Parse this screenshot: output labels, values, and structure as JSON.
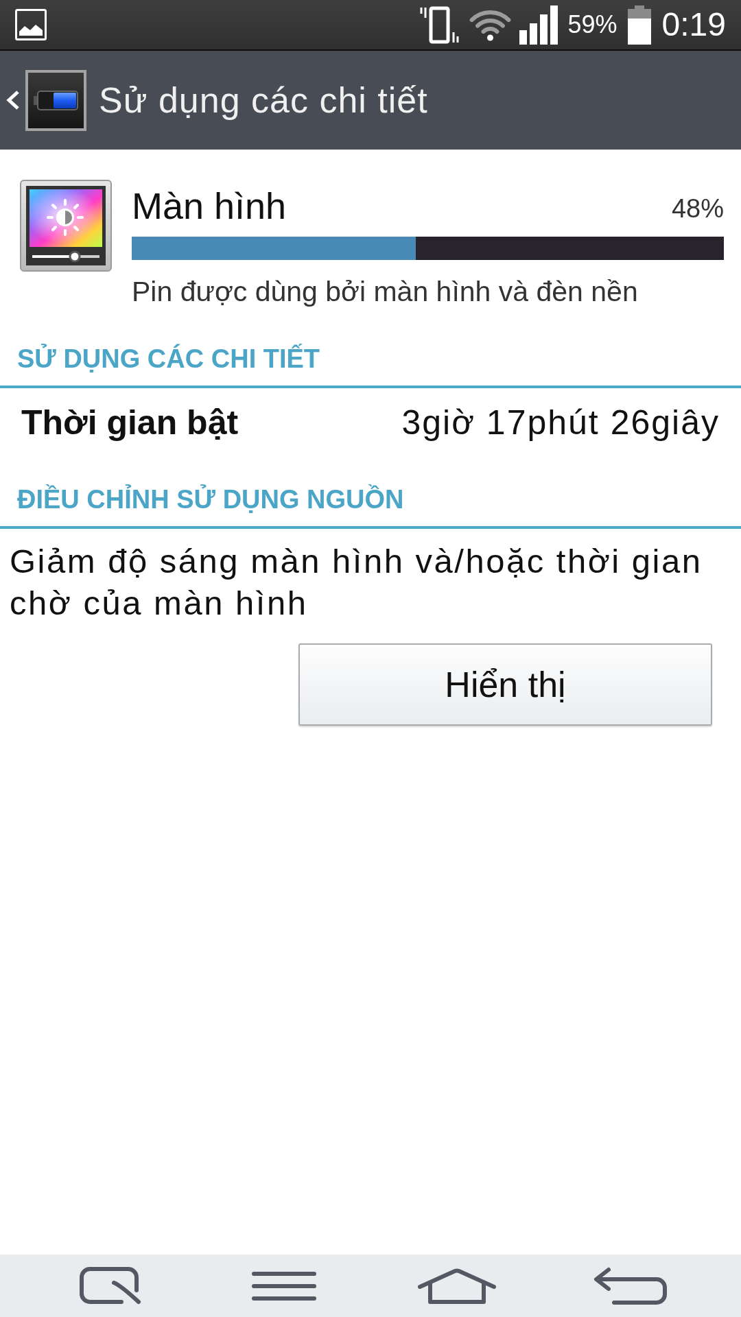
{
  "status_bar": {
    "battery": "59%",
    "time": "0:19"
  },
  "app_bar": {
    "title": "Sử dụng các chi tiết"
  },
  "usage": {
    "name": "Màn hình",
    "percent": "48%",
    "level": 0.48,
    "description": "Pin được dùng bởi màn hình và đèn nền"
  },
  "sections": [
    {
      "kind": "detail",
      "title": "SỬ DỤNG CÁC CHI TIẾT",
      "label": "Thời gian bật",
      "value": "3giờ 17phút 26giây"
    },
    {
      "kind": "advice",
      "title": "ĐIỀU CHỈNH SỬ DỤNG NGUỒN",
      "text": "Giảm độ sáng màn hình và/hoặc thời gian chờ của màn hình",
      "button": "Hiển thị"
    }
  ]
}
